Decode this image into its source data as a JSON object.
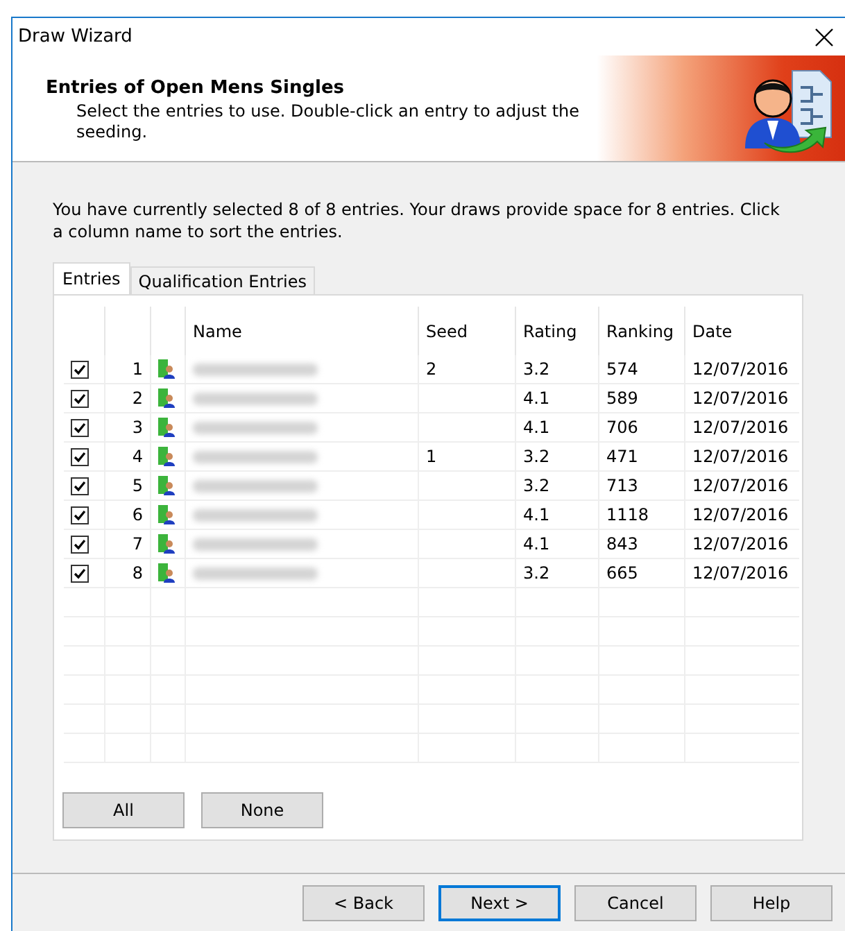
{
  "window": {
    "title": "Draw Wizard"
  },
  "header": {
    "title": "Entries of Open Mens Singles",
    "subtitle": "Select the entries to use. Double-click an entry to adjust the seeding."
  },
  "info": "You have currently selected 8 of 8 entries. Your draws provide space for 8 entries. Click a column name to sort the entries.",
  "tabs": [
    {
      "label": "Entries",
      "selected": true
    },
    {
      "label": "Qualification Entries",
      "selected": false
    }
  ],
  "table": {
    "columns": [
      "Name",
      "Seed",
      "Rating",
      "Ranking",
      "Date"
    ],
    "rows": [
      {
        "checked": true,
        "number": "1",
        "seed": "2",
        "rating": "3.2",
        "ranking": "574",
        "date": "12/07/2016"
      },
      {
        "checked": true,
        "number": "2",
        "rating": "4.1",
        "ranking": "589",
        "date": "12/07/2016"
      },
      {
        "checked": true,
        "number": "3",
        "rating": "4.1",
        "ranking": "706",
        "date": "12/07/2016"
      },
      {
        "checked": true,
        "number": "4",
        "seed": "1",
        "rating": "3.2",
        "ranking": "471",
        "date": "12/07/2016"
      },
      {
        "checked": true,
        "number": "5",
        "rating": "3.2",
        "ranking": "713",
        "date": "12/07/2016"
      },
      {
        "checked": true,
        "number": "6",
        "rating": "4.1",
        "ranking": "1118",
        "date": "12/07/2016"
      },
      {
        "checked": true,
        "number": "7",
        "rating": "4.1",
        "ranking": "843",
        "date": "12/07/2016"
      },
      {
        "checked": true,
        "number": "8",
        "rating": "3.2",
        "ranking": "665",
        "date": "12/07/2016"
      }
    ]
  },
  "selection_buttons": [
    "All",
    "None"
  ],
  "footer_buttons": [
    {
      "label": "< Back",
      "default": false
    },
    {
      "label": "Next >",
      "default": true
    },
    {
      "label": "Cancel",
      "default": false
    },
    {
      "label": "Help",
      "default": false
    }
  ]
}
